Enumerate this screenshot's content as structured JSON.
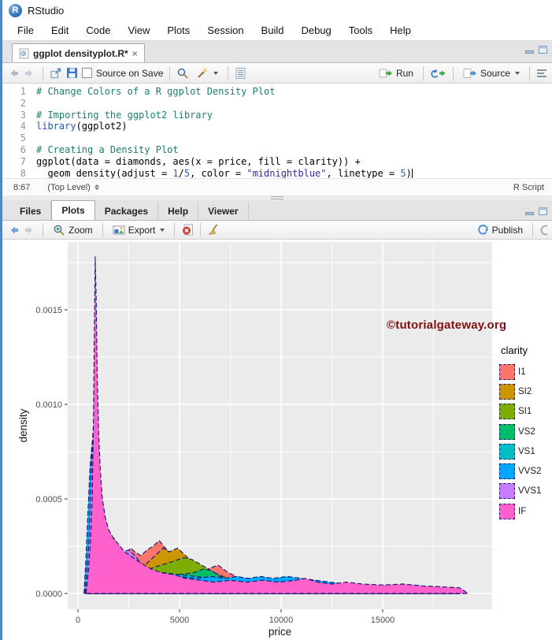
{
  "window": {
    "title": "RStudio"
  },
  "menu": {
    "items": [
      "File",
      "Edit",
      "Code",
      "View",
      "Plots",
      "Session",
      "Build",
      "Debug",
      "Tools",
      "Help"
    ]
  },
  "editor": {
    "tab": {
      "title": "ggplot densityplot.R*",
      "close": "×"
    },
    "toolbar": {
      "source_on_save_label": "Source on Save",
      "run_label": "Run",
      "source_label": "Source"
    },
    "line_numbers": [
      "1",
      "2",
      "3",
      "4",
      "5",
      "6",
      "7",
      "8"
    ],
    "code_lines": [
      [
        {
          "c": "comment",
          "t": "# Change Colors of a R ggplot Density Plot"
        }
      ],
      [],
      [
        {
          "c": "comment",
          "t": "# Importing the ggplot2 library"
        }
      ],
      [
        {
          "c": "kw",
          "t": "library"
        },
        {
          "c": "plain",
          "t": "(ggplot2)"
        }
      ],
      [],
      [
        {
          "c": "comment",
          "t": "# Creating a Density Plot"
        }
      ],
      [
        {
          "c": "plain",
          "t": "ggplot(data = diamonds, aes(x = price, fill = clarity)) +"
        }
      ],
      [
        {
          "c": "plain",
          "t": "  geom_density(adjust = "
        },
        {
          "c": "num",
          "t": "1"
        },
        {
          "c": "plain",
          "t": "/"
        },
        {
          "c": "num",
          "t": "5"
        },
        {
          "c": "plain",
          "t": ", color = "
        },
        {
          "c": "str",
          "t": "\"midnightblue\""
        },
        {
          "c": "plain",
          "t": ", linetype = "
        },
        {
          "c": "num",
          "t": "5"
        },
        {
          "c": "plain",
          "t": ")"
        }
      ]
    ],
    "cursor_after_line": 8,
    "status": {
      "position": "8:67",
      "scope": "(Top Level)",
      "file_type": "R Script"
    }
  },
  "pane": {
    "tabs": [
      {
        "label": "Files",
        "active": false
      },
      {
        "label": "Plots",
        "active": true
      },
      {
        "label": "Packages",
        "active": false
      },
      {
        "label": "Help",
        "active": false
      },
      {
        "label": "Viewer",
        "active": false
      }
    ],
    "toolbar": {
      "zoom_label": "Zoom",
      "export_label": "Export",
      "publish_label": "Publish"
    }
  },
  "watermark": "©tutorialgateway.org",
  "chart_data": {
    "type": "area",
    "variant": "overlaid kernel density curves (ggplot2 geom_density, dashed midnightblue outline)",
    "title": "",
    "xlabel": "price",
    "ylabel": "density",
    "x_ticks": [
      0,
      5000,
      10000,
      15000
    ],
    "x_tick_labels": [
      "0",
      "5000",
      "10000",
      "15000"
    ],
    "x_minor_ticks": [
      2500,
      7500,
      12500,
      17500
    ],
    "y_ticks": [
      0,
      0.0005,
      0.001,
      0.0015
    ],
    "y_tick_labels": [
      "0.0000",
      "0.0005",
      "0.0010",
      "0.0015"
    ],
    "y_minor_ticks": [
      0.00025,
      0.00075,
      0.00125,
      0.00175
    ],
    "xlim": [
      -900,
      20400
    ],
    "ylim": [
      0,
      0.00183
    ],
    "grid": true,
    "panel_bg": "#EBEBEB",
    "grid_color": "#FFFFFF",
    "outline_color": "#191970",
    "outline_linetype": "5 (longdash)",
    "legend": {
      "title": "clarity",
      "position": "right"
    },
    "series": [
      {
        "name": "I1",
        "color": "#F8766D",
        "points": [
          [
            500,
            0
          ],
          [
            1200,
            6e-05
          ],
          [
            1800,
            0.00013
          ],
          [
            2250,
            0.0002
          ],
          [
            2600,
            0.00024
          ],
          [
            2800,
            0.00022
          ],
          [
            3100,
            0.0002
          ],
          [
            3400,
            0.00023
          ],
          [
            3700,
            0.00025
          ],
          [
            4000,
            0.00028
          ],
          [
            4300,
            0.00024
          ],
          [
            4700,
            0.0002
          ],
          [
            5200,
            0.00016
          ],
          [
            5800,
            0.00012
          ],
          [
            6400,
            0.00013
          ],
          [
            6900,
            0.00015
          ],
          [
            7400,
            0.00011
          ],
          [
            8000,
            8e-05
          ],
          [
            9000,
            6e-05
          ],
          [
            10000,
            5e-05
          ],
          [
            11000,
            4.5e-05
          ],
          [
            12000,
            4e-05
          ],
          [
            13000,
            3.5e-05
          ],
          [
            14500,
            3e-05
          ],
          [
            16000,
            2.5e-05
          ],
          [
            17500,
            1.5e-05
          ],
          [
            18700,
            0
          ]
        ]
      },
      {
        "name": "SI2",
        "color": "#CD9600",
        "points": [
          [
            600,
            0
          ],
          [
            1500,
            7e-05
          ],
          [
            2200,
            0.0001
          ],
          [
            2800,
            0.00012
          ],
          [
            3300,
            0.00015
          ],
          [
            3800,
            0.0002
          ],
          [
            4200,
            0.00024
          ],
          [
            4500,
            0.00022
          ],
          [
            4900,
            0.00024
          ],
          [
            5300,
            0.0002
          ],
          [
            5800,
            0.00015
          ],
          [
            6300,
            0.00011
          ],
          [
            7000,
            8e-05
          ],
          [
            8000,
            6e-05
          ],
          [
            9000,
            5e-05
          ],
          [
            10000,
            4.5e-05
          ],
          [
            11000,
            4e-05
          ],
          [
            12000,
            3.5e-05
          ],
          [
            13000,
            4e-05
          ],
          [
            14000,
            4.5e-05
          ],
          [
            15000,
            4e-05
          ],
          [
            16000,
            4.5e-05
          ],
          [
            16800,
            4e-05
          ],
          [
            17500,
            3e-05
          ],
          [
            18200,
            2e-05
          ],
          [
            18800,
            0
          ]
        ]
      },
      {
        "name": "SI1",
        "color": "#7CAE00",
        "points": [
          [
            500,
            0
          ],
          [
            1300,
            8e-05
          ],
          [
            1900,
            0.00013
          ],
          [
            2400,
            0.00015
          ],
          [
            2900,
            0.00014
          ],
          [
            3500,
            0.00013
          ],
          [
            4100,
            0.00015
          ],
          [
            4700,
            0.00017
          ],
          [
            5200,
            0.00019
          ],
          [
            5600,
            0.00018
          ],
          [
            6100,
            0.00015
          ],
          [
            6700,
            0.00011
          ],
          [
            7400,
            8e-05
          ],
          [
            8200,
            6e-05
          ],
          [
            9200,
            5e-05
          ],
          [
            10500,
            4e-05
          ],
          [
            12000,
            3.5e-05
          ],
          [
            13500,
            3e-05
          ],
          [
            15000,
            2.5e-05
          ],
          [
            16500,
            2e-05
          ],
          [
            17800,
            1e-05
          ],
          [
            18600,
            0
          ]
        ]
      },
      {
        "name": "VS2",
        "color": "#00BE67",
        "points": [
          [
            500,
            0
          ],
          [
            900,
            9e-05
          ],
          [
            1300,
            0.0002
          ],
          [
            1600,
            0.00028
          ],
          [
            1750,
            0.0003
          ],
          [
            1950,
            0.00024
          ],
          [
            2200,
            0.00017
          ],
          [
            2600,
            0.00013
          ],
          [
            3200,
            0.0001
          ],
          [
            4000,
            9e-05
          ],
          [
            5000,
            0.0001
          ],
          [
            5700,
            0.00011
          ],
          [
            6200,
            0.00013
          ],
          [
            6600,
            0.00012
          ],
          [
            7000,
            9e-05
          ],
          [
            7600,
            7e-05
          ],
          [
            8400,
            6e-05
          ],
          [
            9500,
            5e-05
          ],
          [
            11000,
            4e-05
          ],
          [
            12500,
            3.5e-05
          ],
          [
            14000,
            3e-05
          ],
          [
            15500,
            2.5e-05
          ],
          [
            17000,
            2e-05
          ],
          [
            18000,
            1e-05
          ],
          [
            18700,
            0
          ]
        ]
      },
      {
        "name": "VS1",
        "color": "#00BFC4",
        "points": [
          [
            450,
            0
          ],
          [
            800,
            0.0001
          ],
          [
            1100,
            0.00018
          ],
          [
            1400,
            0.00024
          ],
          [
            1550,
            0.00026
          ],
          [
            1750,
            0.00022
          ],
          [
            2000,
            0.00017
          ],
          [
            2400,
            0.00013
          ],
          [
            2900,
            0.00011
          ],
          [
            3500,
            0.0001
          ],
          [
            4200,
            0.00011
          ],
          [
            5000,
            0.0001
          ],
          [
            5800,
            9e-05
          ],
          [
            6600,
            8e-05
          ],
          [
            7400,
            8e-05
          ],
          [
            8200,
            7e-05
          ],
          [
            9000,
            7e-05
          ],
          [
            10000,
            6e-05
          ],
          [
            11000,
            5e-05
          ],
          [
            12000,
            4.5e-05
          ],
          [
            13000,
            4e-05
          ],
          [
            14500,
            3.5e-05
          ],
          [
            16000,
            3e-05
          ],
          [
            17500,
            2e-05
          ],
          [
            18300,
            1e-05
          ],
          [
            18800,
            0
          ]
        ]
      },
      {
        "name": "VVS2",
        "color": "#00A9FF",
        "points": [
          [
            300,
            0
          ],
          [
            400,
            0.0002
          ],
          [
            500,
            0.00045
          ],
          [
            600,
            0.00068
          ],
          [
            700,
            0.0008
          ],
          [
            750,
            0.00082
          ],
          [
            850,
            0.00072
          ],
          [
            950,
            0.00058
          ],
          [
            1050,
            0.00046
          ],
          [
            1200,
            0.00036
          ],
          [
            1400,
            0.00028
          ],
          [
            1700,
            0.00023
          ],
          [
            2000,
            0.0002
          ],
          [
            2400,
            0.00016
          ],
          [
            2900,
            0.00013
          ],
          [
            3500,
            0.00011
          ],
          [
            4200,
            0.0001
          ],
          [
            5000,
            9e-05
          ],
          [
            5800,
            8e-05
          ],
          [
            6600,
            9e-05
          ],
          [
            7200,
            8e-05
          ],
          [
            7800,
            9e-05
          ],
          [
            8400,
            8e-05
          ],
          [
            9000,
            9e-05
          ],
          [
            9600,
            8e-05
          ],
          [
            10300,
            9e-05
          ],
          [
            11000,
            8e-05
          ],
          [
            11700,
            7e-05
          ],
          [
            12400,
            6e-05
          ],
          [
            13200,
            5e-05
          ],
          [
            14200,
            4.5e-05
          ],
          [
            15200,
            4e-05
          ],
          [
            16200,
            3.5e-05
          ],
          [
            17200,
            3e-05
          ],
          [
            18200,
            2e-05
          ],
          [
            18900,
            0
          ]
        ]
      },
      {
        "name": "VVS1",
        "color": "#C77CFF",
        "points": [
          [
            350,
            0
          ],
          [
            450,
            0.00012
          ],
          [
            550,
            0.0003
          ],
          [
            650,
            0.00062
          ],
          [
            720,
            0.00082
          ],
          [
            800,
            0.00095
          ],
          [
            870,
            0.00088
          ],
          [
            950,
            0.00068
          ],
          [
            1050,
            0.0005
          ],
          [
            1180,
            0.00038
          ],
          [
            1350,
            0.0003
          ],
          [
            1600,
            0.00025
          ],
          [
            1900,
            0.00021
          ],
          [
            2200,
            0.00022
          ],
          [
            2500,
            0.00023
          ],
          [
            2800,
            0.0002
          ],
          [
            3100,
            0.00016
          ],
          [
            3500,
            0.00012
          ],
          [
            4000,
            0.0001
          ],
          [
            4600,
            8e-05
          ],
          [
            5300,
            7e-05
          ],
          [
            6100,
            6e-05
          ],
          [
            7000,
            5e-05
          ],
          [
            8000,
            4.5e-05
          ],
          [
            9000,
            4e-05
          ],
          [
            10200,
            4e-05
          ],
          [
            11500,
            3.5e-05
          ],
          [
            13000,
            3e-05
          ],
          [
            14500,
            2.5e-05
          ],
          [
            16000,
            2e-05
          ],
          [
            17300,
            1.5e-05
          ],
          [
            18300,
            1e-05
          ],
          [
            18800,
            0
          ]
        ]
      },
      {
        "name": "IF",
        "color": "#FF61CC",
        "points": [
          [
            400,
            0
          ],
          [
            520,
            0.00012
          ],
          [
            620,
            0.00028
          ],
          [
            700,
            0.0005
          ],
          [
            760,
            0.0009
          ],
          [
            810,
            0.0014
          ],
          [
            850,
            0.00178
          ],
          [
            900,
            0.00155
          ],
          [
            950,
            0.00115
          ],
          [
            1020,
            0.00085
          ],
          [
            1100,
            0.00065
          ],
          [
            1200,
            0.0005
          ],
          [
            1350,
            0.0004
          ],
          [
            1500,
            0.00034
          ],
          [
            1750,
            0.00029
          ],
          [
            2000,
            0.00026
          ],
          [
            2300,
            0.00022
          ],
          [
            2700,
            0.00019
          ],
          [
            3100,
            0.00016
          ],
          [
            3600,
            0.00013
          ],
          [
            4100,
            0.00011
          ],
          [
            4700,
            0.0001
          ],
          [
            5300,
            8e-05
          ],
          [
            6000,
            7e-05
          ],
          [
            6700,
            6e-05
          ],
          [
            7500,
            7e-05
          ],
          [
            8300,
            6e-05
          ],
          [
            9100,
            7e-05
          ],
          [
            9900,
            6e-05
          ],
          [
            10700,
            7e-05
          ],
          [
            11200,
            8e-05
          ],
          [
            11800,
            6e-05
          ],
          [
            12500,
            5e-05
          ],
          [
            13200,
            6e-05
          ],
          [
            14000,
            5e-05
          ],
          [
            15000,
            4.5e-05
          ],
          [
            16000,
            5e-05
          ],
          [
            17000,
            4e-05
          ],
          [
            18000,
            3.5e-05
          ],
          [
            18800,
            3e-05
          ],
          [
            19200,
            0
          ]
        ]
      }
    ]
  }
}
